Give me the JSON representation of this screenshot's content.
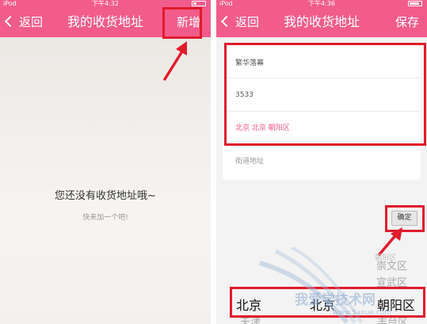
{
  "left_screen": {
    "status": {
      "carrier": "iPod",
      "time": "下午4:32"
    },
    "nav": {
      "back_label": "返回",
      "title": "我的收货地址",
      "action_label": "新增"
    },
    "empty_title": "您还没有收货地址哦~",
    "empty_subtitle": "快来加一个吧!"
  },
  "right_screen": {
    "status": {
      "carrier": "iPod",
      "time": "下午4:36"
    },
    "nav": {
      "back_label": "返回",
      "title": "我的收货地址",
      "action_label": "保存"
    },
    "form": {
      "name_value": "繁华落幕",
      "phone_value": "3533",
      "region_value": "北京 北京 朝阳区",
      "street_placeholder": "街道地址"
    },
    "confirm_label": "确定",
    "picker": {
      "above_col3": [
        "朝阳区",
        "崇文区",
        "宣武区"
      ],
      "selected": [
        "北京",
        "北京",
        "朝阳区"
      ],
      "below_col1": "天津",
      "below_col3": "丰台区"
    }
  },
  "watermark": {
    "text": "我爱学技术网",
    "url": "www.5axue.com"
  },
  "colors": {
    "brand_pink": "#f25c8c",
    "highlight_red": "#e01b2b",
    "region_text": "#ee5a8c"
  }
}
